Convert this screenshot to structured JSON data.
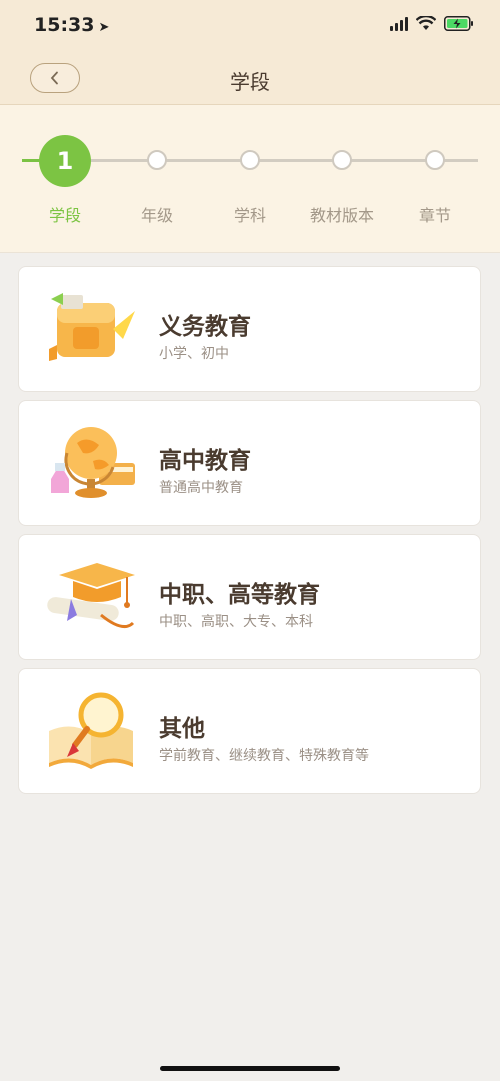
{
  "status": {
    "time": "15:33"
  },
  "nav": {
    "title": "学段"
  },
  "stepper": {
    "active_number": "1",
    "steps": [
      "学段",
      "年级",
      "学科",
      "教材版本",
      "章节"
    ]
  },
  "cards": [
    {
      "title": "义务教育",
      "subtitle": "小学、初中",
      "icon": "school-bag-icon"
    },
    {
      "title": "高中教育",
      "subtitle": "普通高中教育",
      "icon": "globe-icon"
    },
    {
      "title": "中职、高等教育",
      "subtitle": "中职、高职、大专、本科",
      "icon": "graduation-cap-icon"
    },
    {
      "title": "其他",
      "subtitle": "学前教育、继续教育、特殊教育等",
      "icon": "book-magnifier-icon"
    }
  ],
  "colors": {
    "accent": "#7cc443",
    "header_bg": "#f6ead6",
    "page_bg": "#f1efec"
  }
}
